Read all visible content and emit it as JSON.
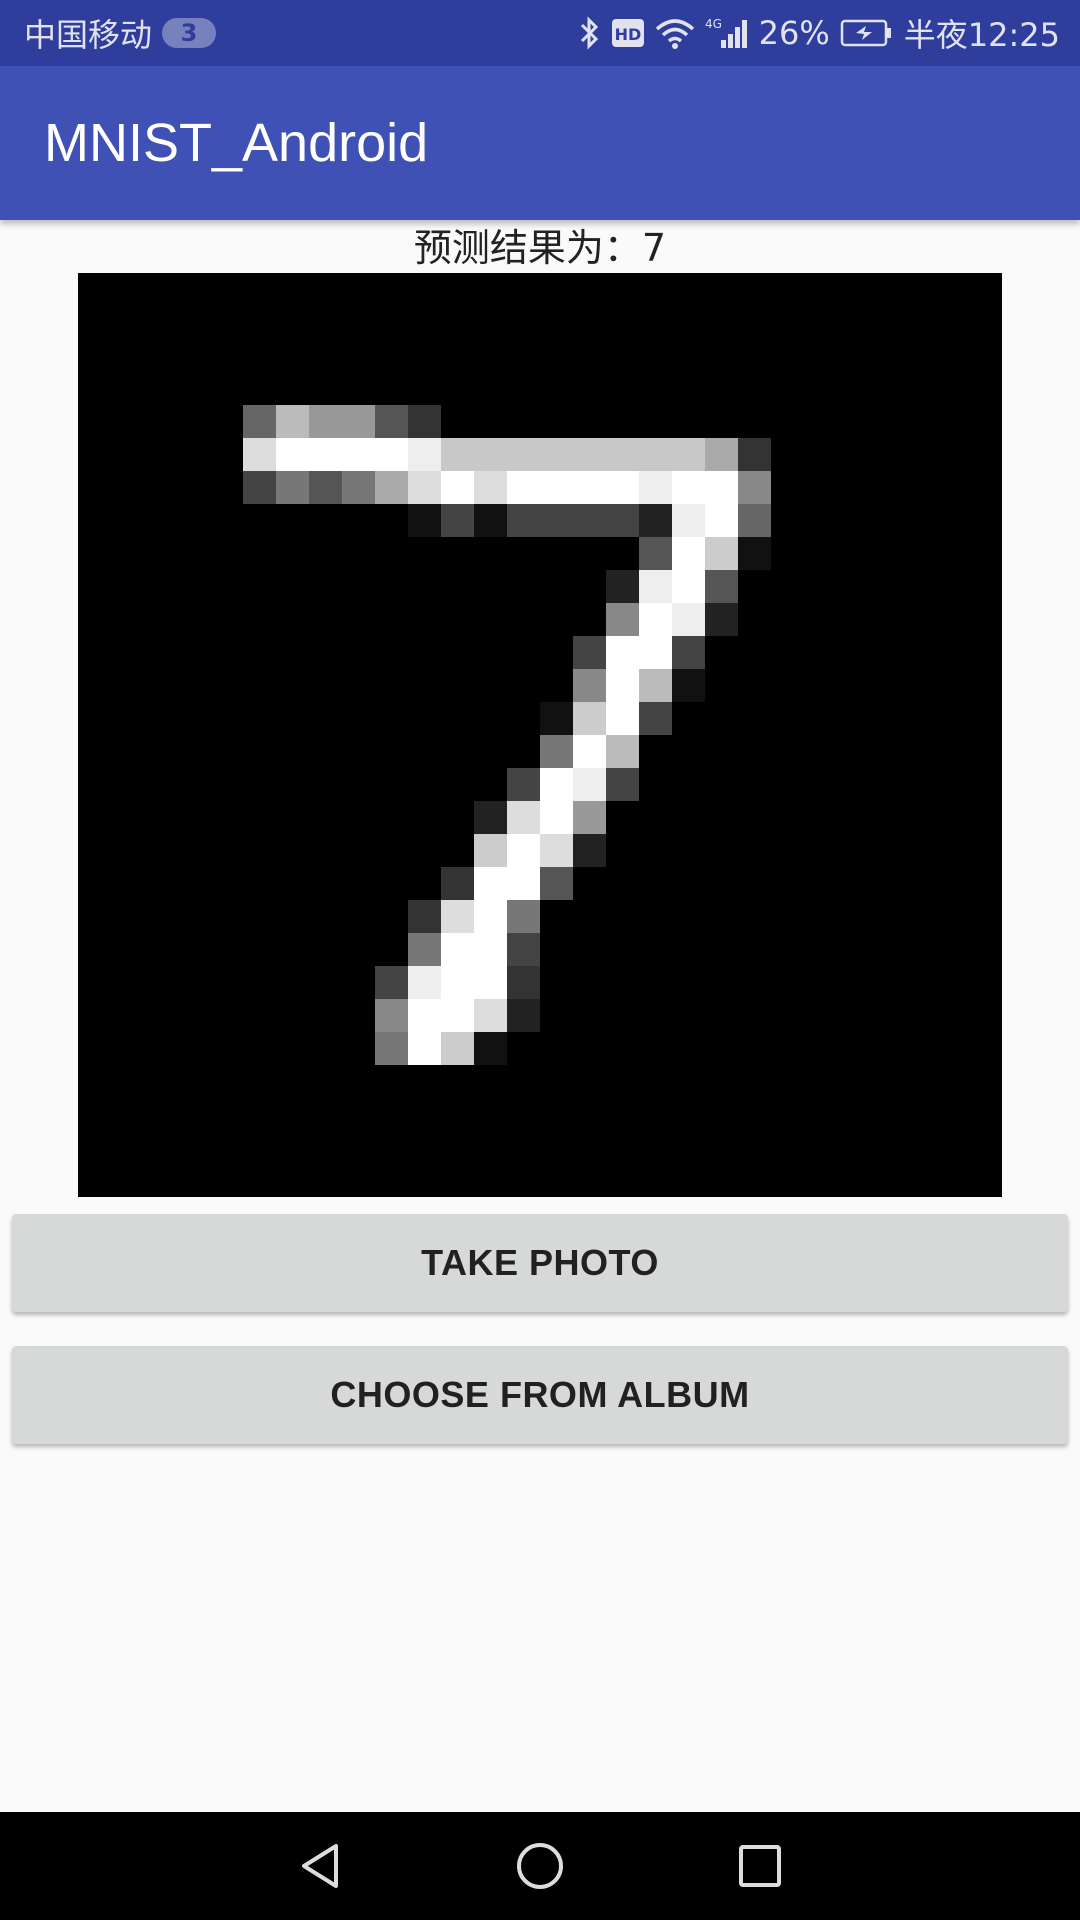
{
  "status_bar": {
    "carrier": "中国移动",
    "sim_badge": "3",
    "network_label": "4G",
    "battery": "26%",
    "time": "半夜12:25",
    "icons": [
      "bluetooth-icon",
      "hd-icon",
      "wifi-icon",
      "signal-icon",
      "battery-charging-icon"
    ]
  },
  "app_bar": {
    "title": "MNIST_Android",
    "color": "#3f51b5",
    "status_color": "#2f3e9c"
  },
  "main": {
    "result_text": "预测结果为：7",
    "image_icon": "mnist-digit-seven-image",
    "take_photo_label": "TAKE PHOTO",
    "choose_album_label": "CHOOSE FROM ALBUM"
  },
  "nav_bar": {
    "icons": [
      "back-icon",
      "home-icon",
      "recent-apps-icon"
    ]
  }
}
